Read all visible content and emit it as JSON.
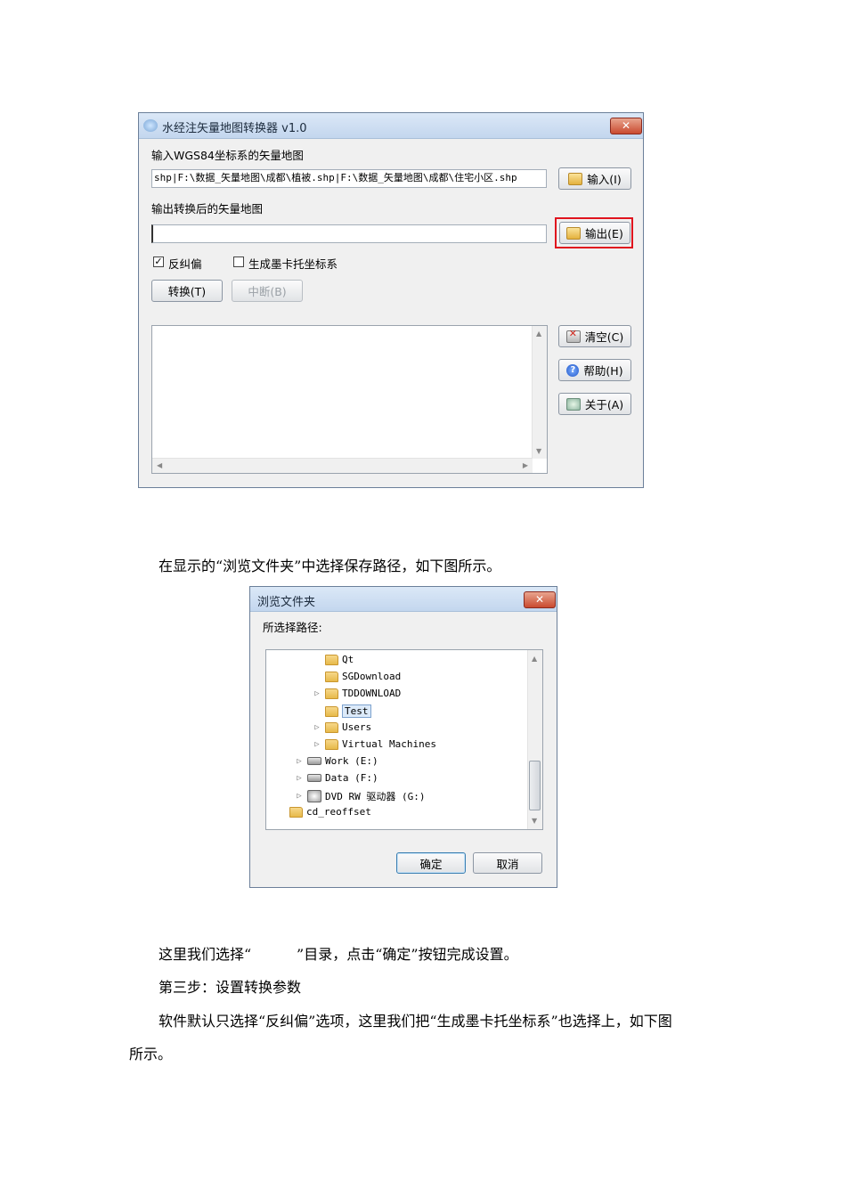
{
  "converter": {
    "title": "水经注矢量地图转换器 v1.0",
    "input_label": "输入WGS84坐标系的矢量地图",
    "input_value": "shp|F:\\数据_矢量地图\\成都\\植被.shp|F:\\数据_矢量地图\\成都\\住宅小区.shp",
    "input_button": "输入(I)",
    "output_label": "输出转换后的矢量地图",
    "output_value": "",
    "output_button": "输出(E)",
    "checkbox_correct": {
      "label": "反纠偏",
      "checked": true,
      "mark": "✓"
    },
    "checkbox_mercator": {
      "label": "生成墨卡托坐标系",
      "checked": false,
      "mark": ""
    },
    "convert_button": "转换(T)",
    "abort_button": "中断(B)",
    "clear_button": "清空(C)",
    "help_button": "帮助(H)",
    "about_button": "关于(A)",
    "close": "✕",
    "highlight_color": "#e0141e"
  },
  "text": {
    "p1": "在显示的“浏览文件夹”中选择保存路径，如下图所示。",
    "p2": "这里我们选择“          ”目录，点击“确定”按钮完成设置。",
    "p3": "第三步：设置转换参数",
    "p4": "软件默认只选择“反纠偏”选项，这里我们把“生成墨卡托坐标系”也选择上，如下图",
    "p5": "所示。"
  },
  "browse": {
    "title": "浏览文件夹",
    "prompt": "所选择路径:",
    "close": "✕",
    "items": [
      {
        "label": "Qt",
        "icon": "folder-icon",
        "expander": ""
      },
      {
        "label": "SGDownload",
        "icon": "folder-icon",
        "expander": ""
      },
      {
        "label": "TDDOWNLOAD",
        "icon": "folder-icon",
        "expander": "▷"
      },
      {
        "label": "Test",
        "icon": "folder-icon",
        "expander": "",
        "selected": true
      },
      {
        "label": "Users",
        "icon": "folder-icon",
        "expander": "▷"
      },
      {
        "label": "Virtual Machines",
        "icon": "folder-icon",
        "expander": "▷"
      },
      {
        "label": "Work (E:)",
        "icon": "drive-icon",
        "expander": "▷"
      },
      {
        "label": "Data (F:)",
        "icon": "drive-icon",
        "expander": "▷"
      },
      {
        "label": "DVD RW 驱动器 (G:)",
        "icon": "dvd-drive-icon",
        "expander": "▷"
      },
      {
        "label": "cd_reoffset",
        "icon": "folder-icon",
        "expander": ""
      }
    ],
    "ok_button": "确定",
    "cancel_button": "取消"
  }
}
